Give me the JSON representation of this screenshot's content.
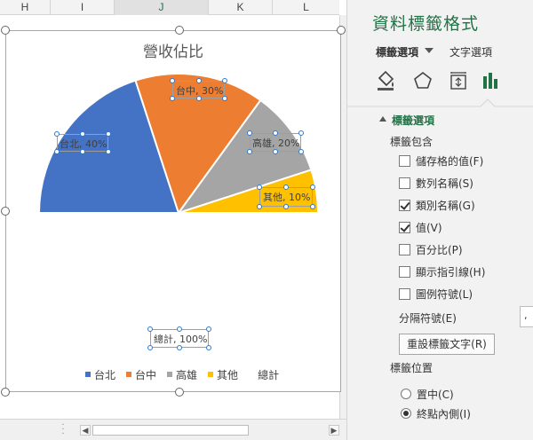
{
  "sheet": {
    "columns": [
      "H",
      "I",
      "J",
      "K",
      "L"
    ],
    "selected_column": "J"
  },
  "chart": {
    "title": "營收佔比",
    "data_labels": {
      "taipei": "台北, 40%",
      "taichung": "台中, 30%",
      "kaohsiung": "高雄, 20%",
      "others": "其他, 10%",
      "total": "總計, 100%"
    },
    "legend": [
      {
        "name": "台北",
        "color": "#4472c4"
      },
      {
        "name": "台中",
        "color": "#ed7d31"
      },
      {
        "name": "高雄",
        "color": "#a5a5a5"
      },
      {
        "name": "其他",
        "color": "#ffc000"
      },
      {
        "name": "總計",
        "color": null
      }
    ],
    "colors": {
      "taipei": "#4472c4",
      "taichung": "#ed7d31",
      "kaohsiung": "#a5a5a5",
      "others": "#ffc000"
    }
  },
  "chart_data": {
    "type": "pie",
    "title": "營收佔比",
    "categories": [
      "台北",
      "台中",
      "高雄",
      "其他",
      "總計"
    ],
    "values": [
      40,
      30,
      20,
      10,
      100
    ],
    "label_format": "category, percent",
    "note_visible": "half-pie: the 總計 slice fills the hidden lower half",
    "legend_position": "bottom"
  },
  "pane": {
    "title": "資料標籤格式",
    "tab_label_options": "標籤選項",
    "tab_text_options": "文字選項",
    "icons": [
      "fill-line-icon",
      "effects-pentagon-icon",
      "size-properties-icon",
      "label-options-bar-chart-icon"
    ],
    "accent_color": "#217346",
    "section_title": "標籤選項",
    "label_contains": "標籤包含",
    "options": [
      {
        "label": "儲存格的值(F)",
        "checked": false
      },
      {
        "label": "數列名稱(S)",
        "checked": false
      },
      {
        "label": "類別名稱(G)",
        "checked": true
      },
      {
        "label": "值(V)",
        "checked": true
      },
      {
        "label": "百分比(P)",
        "checked": false
      },
      {
        "label": "顯示指引線(H)",
        "checked": false
      },
      {
        "label": "圖例符號(L)",
        "checked": false
      }
    ],
    "separator_label": "分隔符號(E)",
    "separator_value": ",",
    "reset_button": "重設標籤文字(R)",
    "label_position": "標籤位置",
    "positions": [
      {
        "label": "置中(C)",
        "selected": false
      },
      {
        "label": "終點內側(I)",
        "selected": true
      }
    ]
  }
}
